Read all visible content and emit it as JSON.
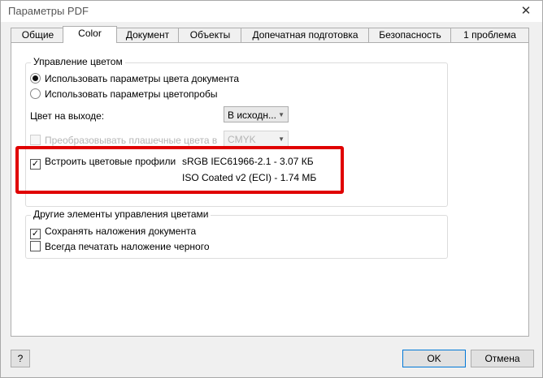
{
  "window": {
    "title": "Параметры PDF",
    "close_glyph": "✕"
  },
  "tabs": [
    {
      "label": "Общие",
      "active": false
    },
    {
      "label": "Color",
      "active": true
    },
    {
      "label": "Документ",
      "active": false
    },
    {
      "label": "Объекты",
      "active": false
    },
    {
      "label": "Допечатная подготовка",
      "active": false
    },
    {
      "label": "Безопасность",
      "active": false
    },
    {
      "label": "1 проблема",
      "active": false
    }
  ],
  "color_management": {
    "group_label": "Управление цветом",
    "radio_doc": {
      "label": "Использовать параметры цвета документа",
      "selected": true
    },
    "radio_proof": {
      "label": "Использовать параметры цветопробы",
      "selected": false
    },
    "output_label": "Цвет на выходе:",
    "output_value": "В исходн...",
    "spot_checkbox": {
      "label": "Преобразовывать плашечные цвета в",
      "checked": false,
      "disabled": true
    },
    "spot_value": "CMYK",
    "embed_checkbox": {
      "label": "Встроить цветовые профили",
      "checked": true
    },
    "profiles": [
      "sRGB IEC61966-2.1 - 3.07 КБ",
      "ISO Coated v2 (ECI) - 1.74 МБ"
    ]
  },
  "other": {
    "group_label": "Другие элементы управления цветами",
    "preserve_overprint": {
      "label": "Сохранять наложения документа",
      "checked": true
    },
    "always_overprint_black": {
      "label": "Всегда печатать наложение черного",
      "checked": false
    }
  },
  "buttons": {
    "help": "?",
    "ok": "OK",
    "cancel": "Отмена"
  },
  "colors": {
    "highlight": "#e00000",
    "accent": "#0078d7"
  }
}
